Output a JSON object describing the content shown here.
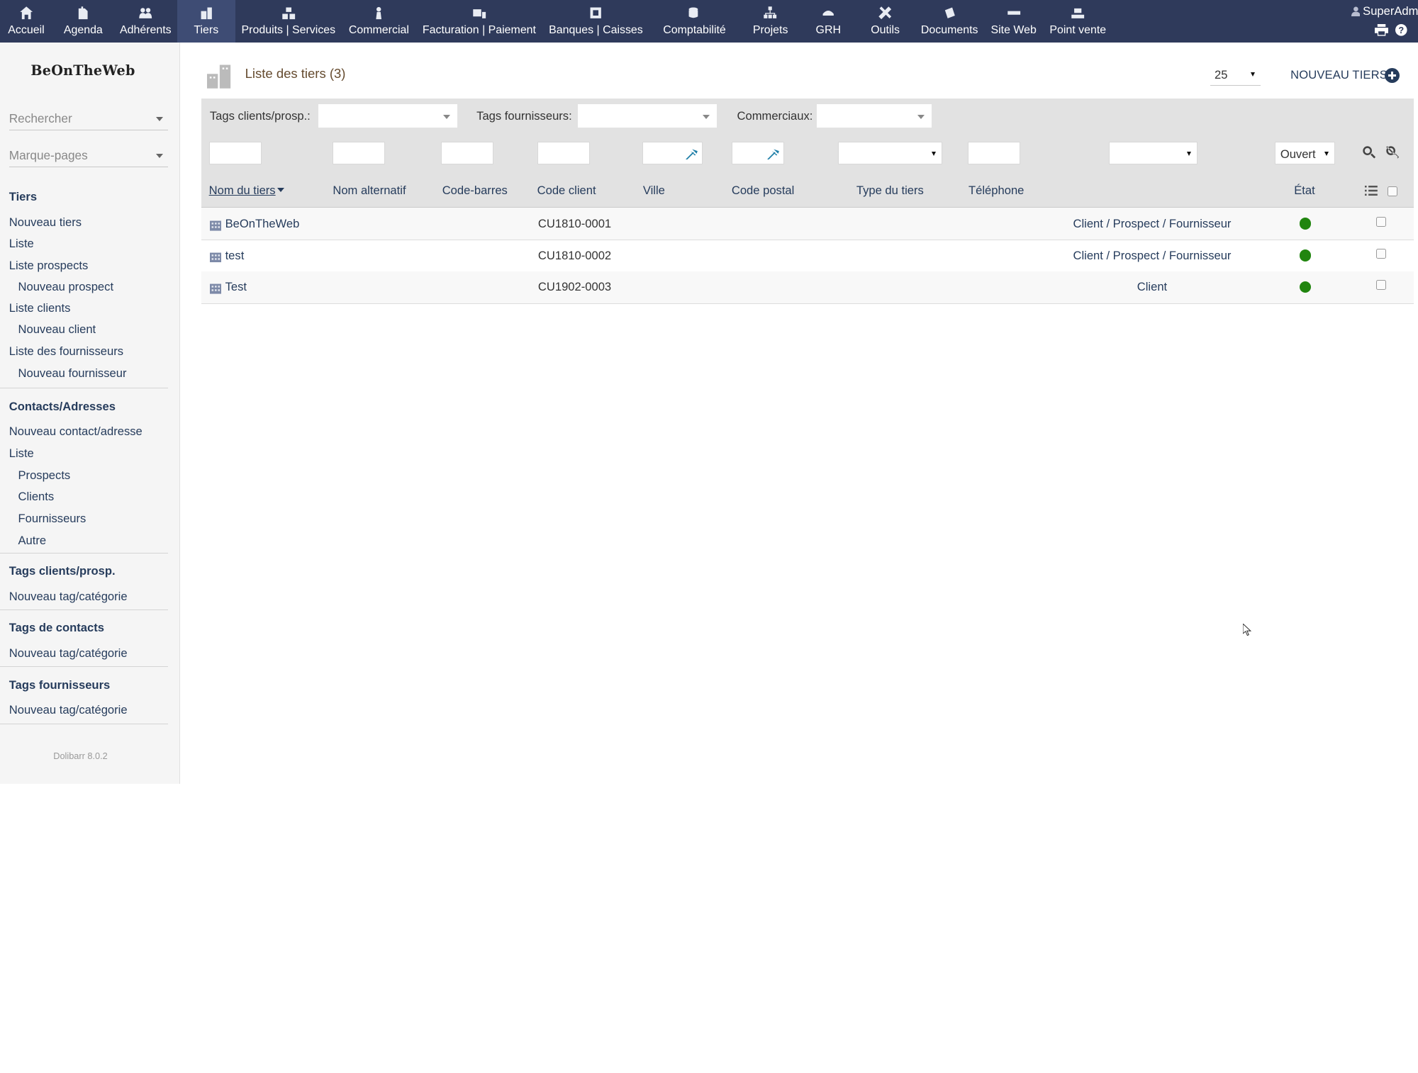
{
  "topnav": {
    "items": [
      {
        "label": "Accueil",
        "icon": "home-icon"
      },
      {
        "label": "Agenda",
        "icon": "agenda-icon"
      },
      {
        "label": "Adhérents",
        "icon": "members-icon"
      },
      {
        "label": "Tiers",
        "icon": "company-icon",
        "active": true
      },
      {
        "label": "Produits | Services",
        "icon": "products-icon"
      },
      {
        "label": "Commercial",
        "icon": "commercial-icon"
      },
      {
        "label": "Facturation | Paiement",
        "icon": "billing-icon"
      },
      {
        "label": "Banques | Caisses",
        "icon": "bank-icon"
      },
      {
        "label": "Comptabilité",
        "icon": "accounting-icon"
      },
      {
        "label": "Projets",
        "icon": "projects-icon"
      },
      {
        "label": "GRH",
        "icon": "hrm-icon"
      },
      {
        "label": "Outils",
        "icon": "tools-icon"
      },
      {
        "label": "Documents",
        "icon": "documents-icon"
      },
      {
        "label": "Site Web",
        "icon": "website-icon"
      },
      {
        "label": "Point vente",
        "icon": "pos-icon"
      }
    ],
    "user": "SuperAdm"
  },
  "sidebar": {
    "logo": "BeOnTheWeb",
    "search_placeholder": "Rechercher",
    "bookmarks_placeholder": "Marque-pages",
    "tiers_heading": "Tiers",
    "tiers_items": [
      "Nouveau tiers",
      "Liste",
      "Liste prospects",
      "Nouveau prospect",
      "Liste clients",
      "Nouveau client",
      "Liste des fournisseurs",
      "Nouveau fournisseur"
    ],
    "contacts_heading": "Contacts/Adresses",
    "contacts_items": [
      "Nouveau contact/adresse",
      "Liste",
      "Prospects",
      "Clients",
      "Fournisseurs",
      "Autre"
    ],
    "tags_clients_heading": "Tags clients/prosp.",
    "tags_clients_item": "Nouveau tag/catégorie",
    "tags_contacts_heading": "Tags de contacts",
    "tags_contacts_item": "Nouveau tag/catégorie",
    "tags_suppliers_heading": "Tags fournisseurs",
    "tags_suppliers_item": "Nouveau tag/catégorie",
    "version": "Dolibarr 8.0.2"
  },
  "main": {
    "title": "Liste des tiers (3)",
    "limit": "25",
    "new_button": "NOUVEAU TIERS",
    "filters": {
      "tags_clients_label": "Tags clients/prosp.:",
      "tags_suppliers_label": "Tags fournisseurs:",
      "sales_label": "Commerciaux:",
      "status_value": "Ouvert"
    },
    "columns": {
      "name": "Nom du tiers",
      "alt_name": "Nom alternatif",
      "barcode": "Code-barres",
      "client_code": "Code client",
      "town": "Ville",
      "zip": "Code postal",
      "type": "Type du tiers",
      "phone": "Téléphone",
      "status": "État"
    },
    "rows": [
      {
        "name": "BeOnTheWeb",
        "client_code": "CU1810-0001",
        "type": "Client / Prospect / Fournisseur",
        "status": "open"
      },
      {
        "name": "test",
        "client_code": "CU1810-0002",
        "type": "Client / Prospect / Fournisseur",
        "status": "open"
      },
      {
        "name": "Test",
        "client_code": "CU1902-0003",
        "type": "Client",
        "status": "open"
      }
    ]
  },
  "colors": {
    "topbar_bg": "#2f3a5b",
    "link": "#263c5c",
    "status_open": "#21850f",
    "title_brown": "#654b2f"
  }
}
